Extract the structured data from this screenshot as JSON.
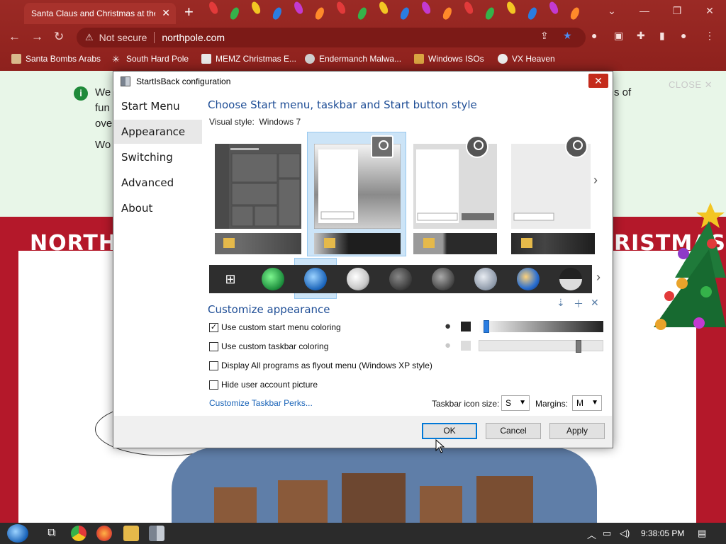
{
  "browser": {
    "tab_title": "Santa Claus and Christmas at the",
    "url": "northpole.com",
    "security": "Not secure",
    "new_tab": "+",
    "tab_close": "✕",
    "bookmarks": [
      {
        "label": "Santa Bombs Arabs",
        "icon": "stick-figure-icon"
      },
      {
        "label": "South Hard Pole",
        "icon": "snowflake-icon"
      },
      {
        "label": "MEMZ Christmas E...",
        "icon": "page-icon"
      },
      {
        "label": "Endermanch Malwa...",
        "icon": "skull-icon"
      },
      {
        "label": "Windows ISOs",
        "icon": "figure-icon"
      },
      {
        "label": "VX Heaven",
        "icon": "biohazard-icon"
      }
    ]
  },
  "page": {
    "frag_we": "We",
    "frag_fun": "fun",
    "frag_ove": "ove",
    "frag_wo": "Wo",
    "frag_right": "s of",
    "close": "CLOSE",
    "banner_left": "NORTH",
    "banner_right": "RISTMAS"
  },
  "dialog": {
    "title": "StartIsBack configuration",
    "close_glyph": "✕",
    "sidebar": [
      "Start Menu",
      "Appearance",
      "Switching",
      "Advanced",
      "About"
    ],
    "active_sidebar": "Appearance",
    "style_title": "Choose Start menu, taskbar and Start button style",
    "visual_style_label": "Visual style:",
    "visual_style_value": "Windows 7",
    "customize_title": "Customize appearance",
    "checkboxes": [
      {
        "label": "Use custom start menu coloring",
        "checked": true
      },
      {
        "label": "Use custom taskbar coloring",
        "checked": false
      },
      {
        "label": "Display All programs as flyout menu (Windows XP style)",
        "checked": false
      },
      {
        "label": "Hide user account picture",
        "checked": false
      }
    ],
    "check_mark": "✓",
    "link": "Customize Taskbar Perks...",
    "taskbar_icon_size_label": "Taskbar icon size:",
    "taskbar_icon_size_value": "S",
    "margins_label": "Margins:",
    "margins_value": "M",
    "sliders": {
      "start_menu_level": 0.04,
      "taskbar_level": 0.81
    },
    "buttons": {
      "ok": "OK",
      "cancel": "Cancel",
      "apply": "Apply"
    },
    "accent_color": "#1f4e96"
  },
  "taskbar": {
    "time": "9:38:05 PM"
  }
}
